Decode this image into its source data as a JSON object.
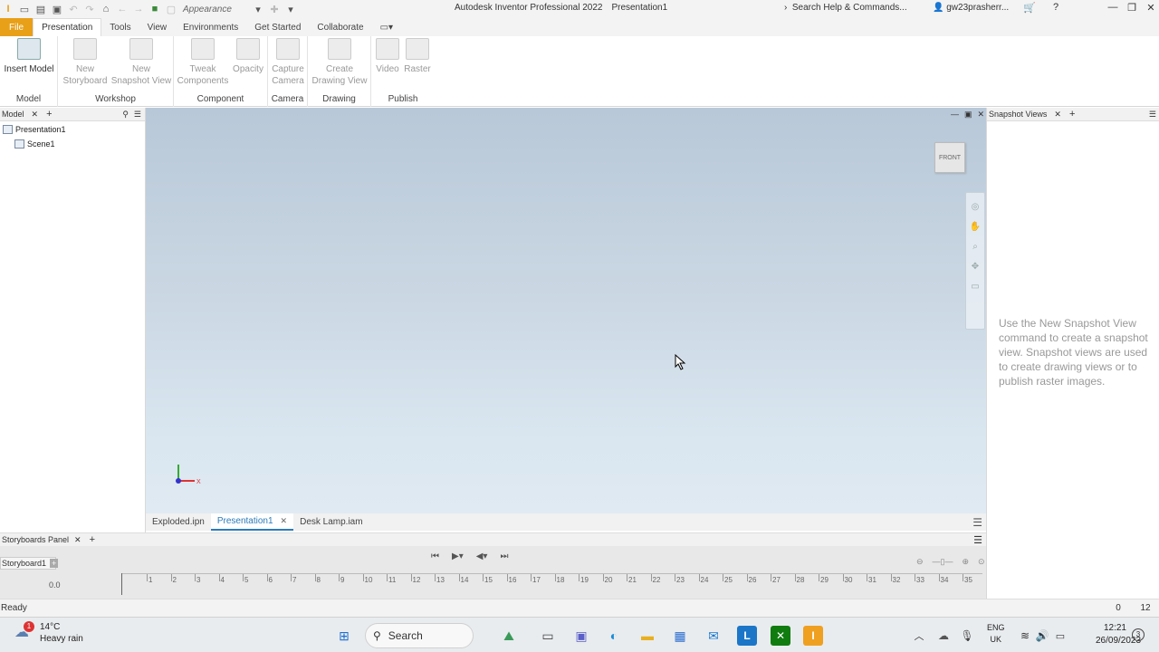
{
  "titlebar": {
    "appearance_label": "Appearance",
    "app_title": "Autodesk Inventor Professional 2022",
    "doc_title": "Presentation1",
    "help_search": "Search Help & Commands...",
    "user": "gw23prasherr..."
  },
  "ribbon_tabs": [
    "File",
    "Presentation",
    "Tools",
    "View",
    "Environments",
    "Get Started",
    "Collaborate"
  ],
  "ribbon": {
    "model": {
      "title": "Model",
      "insert_model": "Insert Model"
    },
    "workshop": {
      "title": "Workshop",
      "new_storyboard_1": "New",
      "new_storyboard_2": "Storyboard",
      "new_snapshot_1": "New",
      "new_snapshot_2": "Snapshot View"
    },
    "component": {
      "title": "Component",
      "tweak_1": "Tweak",
      "tweak_2": "Components",
      "opacity": "Opacity"
    },
    "camera": {
      "title": "Camera",
      "capture_1": "Capture",
      "capture_2": "Camera"
    },
    "drawing": {
      "title": "Drawing",
      "create_1": "Create",
      "create_2": "Drawing View"
    },
    "publish": {
      "title": "Publish",
      "video": "Video",
      "raster": "Raster"
    }
  },
  "model_panel": {
    "title": "Model",
    "tree": [
      "Presentation1",
      "Scene1"
    ]
  },
  "viewport": {
    "viewcube_label": "FRONT",
    "axis_x": "X"
  },
  "doc_tabs": [
    "Exploded.ipn",
    "Presentation1",
    "Desk Lamp.iam"
  ],
  "snapshot_panel": {
    "title": "Snapshot Views",
    "message": "Use the New Snapshot View command to create a snapshot view. Snapshot views are used to create drawing views or to publish raster images."
  },
  "storyboard": {
    "panel_title": "Storyboards Panel",
    "tab": "Storyboard1",
    "current_time": "0.0",
    "ruler_labels": [
      "1",
      "2",
      "3",
      "4",
      "5",
      "6",
      "7",
      "8",
      "9",
      "10",
      "11",
      "12",
      "13",
      "14",
      "15",
      "16",
      "17",
      "18",
      "19",
      "20",
      "21",
      "22",
      "23",
      "24",
      "25",
      "26",
      "27",
      "28",
      "29",
      "30",
      "31",
      "32",
      "33",
      "34",
      "35"
    ]
  },
  "status": {
    "text": "Ready",
    "count_a": "0",
    "count_b": "12"
  },
  "taskbar": {
    "weather_temp": "14°C",
    "weather_desc": "Heavy rain",
    "weather_badge": "1",
    "search": "Search",
    "lang_1": "ENG",
    "lang_2": "UK",
    "time": "12:21",
    "date": "26/09/2023",
    "notif": "3"
  }
}
